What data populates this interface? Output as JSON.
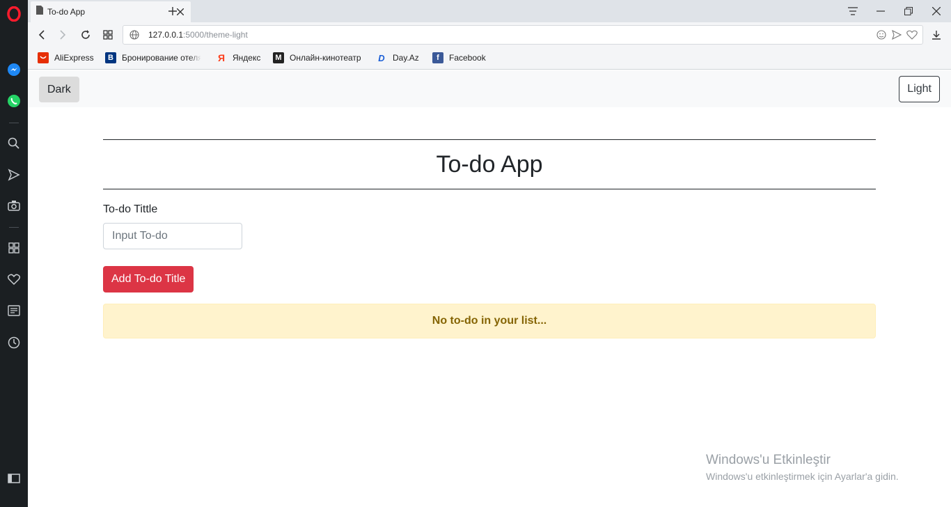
{
  "browser": {
    "tab_title": "To-do App",
    "url_host": "127.0.0.1",
    "url_path": ":5000/theme-light",
    "bookmarks": [
      {
        "label": "AliExpress",
        "icon": "aliexpress-icon",
        "color": "#e62e04"
      },
      {
        "label": "Бронирование отеля",
        "icon": "booking-icon",
        "color": "#003580"
      },
      {
        "label": "Яндекс",
        "icon": "yandex-icon",
        "color": "#fc3f1d"
      },
      {
        "label": "Онлайн-кинотеатр",
        "icon": "kinoteatr-icon",
        "color": "#222222"
      },
      {
        "label": "Day.Az",
        "icon": "dayaz-icon",
        "color": "#1a5ed6"
      },
      {
        "label": "Facebook",
        "icon": "facebook-icon",
        "color": "#3b5998"
      }
    ]
  },
  "app": {
    "dark_button": "Dark",
    "light_button": "Light",
    "title": "To-do App",
    "field_label": "To-do Tittle",
    "input_placeholder": "Input To-do",
    "add_button": "Add To-do Title",
    "empty_message": "No to-do in your list..."
  },
  "watermark": {
    "line1": "Windows'u Etkinleştir",
    "line2": "Windows'u etkinleştirmek için Ayarlar'a gidin."
  },
  "colors": {
    "accent_red": "#dc3545",
    "alert_bg": "#fff3cd",
    "alert_text": "#856404"
  }
}
